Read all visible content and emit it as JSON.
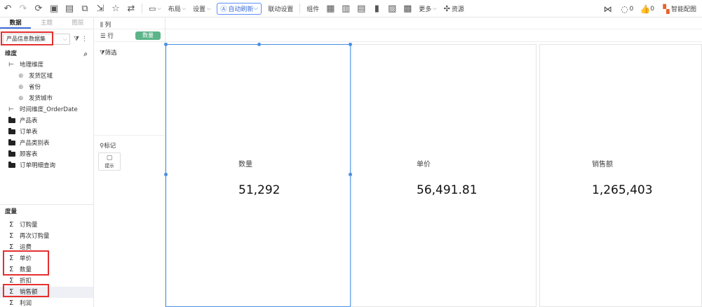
{
  "toolbar": {
    "buttons": [
      "撤销",
      "重做",
      "刷新",
      "保存",
      "另存为",
      "预览",
      "导出",
      "收藏",
      "切换"
    ],
    "screen_icon": "显示器",
    "menus": [
      {
        "label": "布局"
      },
      {
        "label": "设置"
      }
    ],
    "auto_refresh": "自动刷新",
    "linkage": "联动设置",
    "component": "组件",
    "more": "更多",
    "resource": "资源",
    "share": "分享",
    "comments_count": "0",
    "likes_count": "0",
    "smart_chart": "智能配图"
  },
  "data_panel": {
    "tabs": [
      "数据",
      "主题",
      "图层"
    ],
    "dataset": "产品信息数据集",
    "dimensions_title": "维度",
    "dimensions": [
      {
        "label": "地理维度",
        "level": 0,
        "icon": "hierarchy-icon"
      },
      {
        "label": "发货区域",
        "level": 1,
        "icon": "globe-icon"
      },
      {
        "label": "省份",
        "level": 1,
        "icon": "globe-icon"
      },
      {
        "label": "发货城市",
        "level": 1,
        "icon": "globe-icon"
      },
      {
        "label": "时间维度_OrderDate",
        "level": 0,
        "icon": "hierarchy-icon"
      },
      {
        "label": "产品表",
        "level": 0,
        "icon": "folder-icon"
      },
      {
        "label": "订单表",
        "level": 0,
        "icon": "folder-icon"
      },
      {
        "label": "产品类别表",
        "level": 0,
        "icon": "folder-icon"
      },
      {
        "label": "顾客表",
        "level": 0,
        "icon": "folder-icon"
      },
      {
        "label": "订单明细查询",
        "level": 0,
        "icon": "folder-icon"
      }
    ],
    "measures_title": "度量",
    "measures": [
      "订购量",
      "再次订购量",
      "运费",
      "单价",
      "数量",
      "折扣",
      "销售额",
      "利润"
    ]
  },
  "shelves": {
    "columns": "列",
    "rows": "行",
    "row_pill": "数量",
    "filter": "筛选",
    "marks": "标记",
    "tooltip": "提示"
  },
  "cards": [
    {
      "name": "数量",
      "value": "51,292"
    },
    {
      "name": "单价",
      "value": "56,491.81"
    },
    {
      "name": "销售额",
      "value": "1,265,403"
    }
  ],
  "colors": {
    "accent": "#3e6ed8",
    "pill": "#5cb48a",
    "highlight": "#e52f2f",
    "selection": "#4a90e2"
  }
}
